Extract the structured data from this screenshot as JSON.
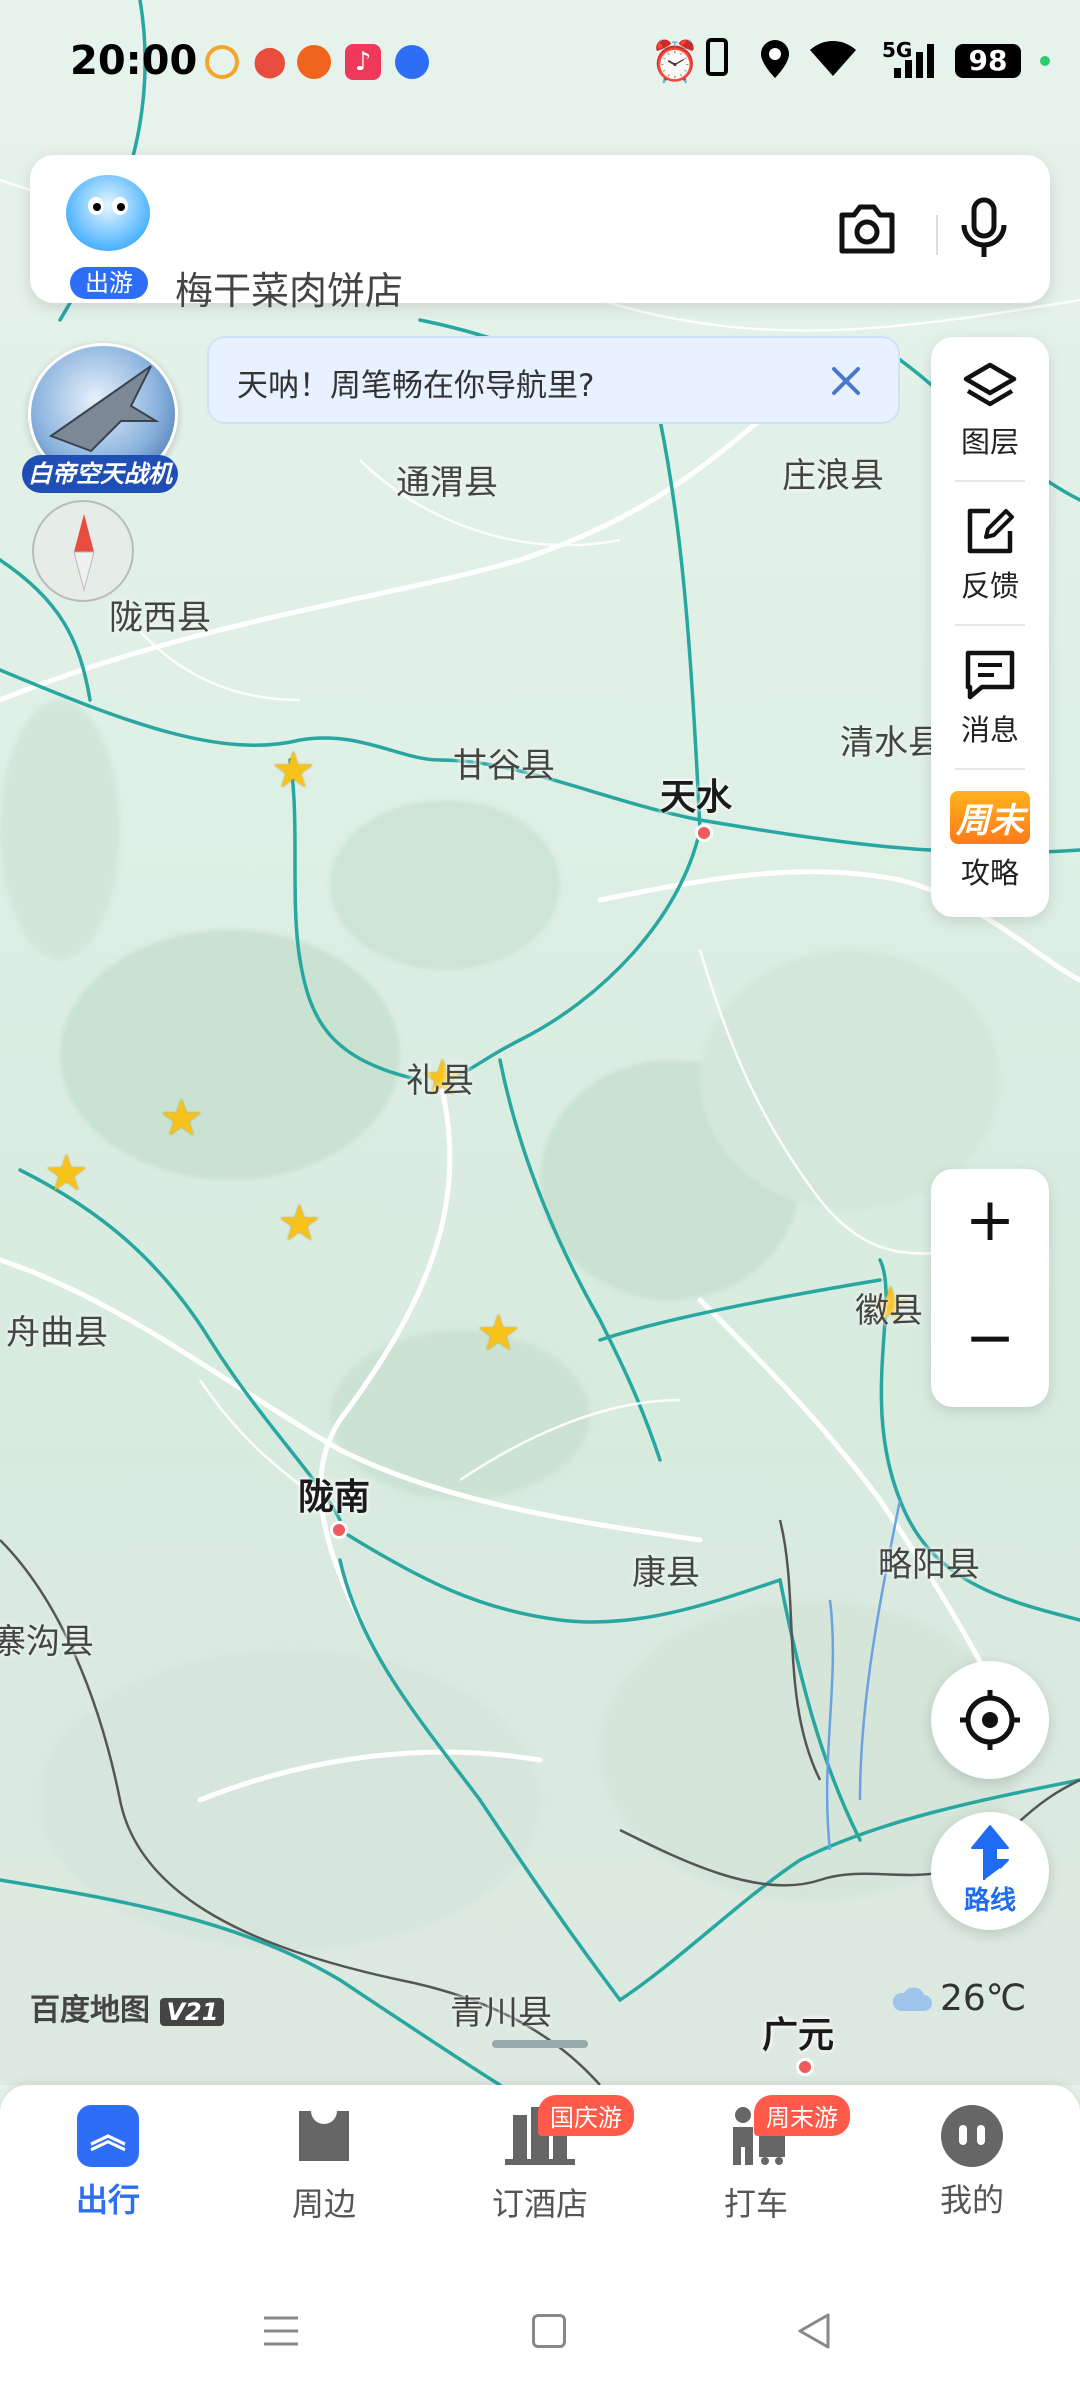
{
  "status_bar": {
    "time": "20:00",
    "network": "5G",
    "battery": "98"
  },
  "search": {
    "avatar_caption": "出游",
    "placeholder_text": "梅干菜肉饼店"
  },
  "promo": {
    "badge_label": "白帝空天战机"
  },
  "notification": {
    "text": "天呐！周笔畅在你导航里?"
  },
  "side_panel": {
    "items": [
      {
        "label": "图层",
        "icon": "layers-icon"
      },
      {
        "label": "反馈",
        "icon": "feedback-icon"
      },
      {
        "label": "消息",
        "icon": "message-icon"
      },
      {
        "label": "攻略",
        "icon": "weekend-guide-icon",
        "icon_text": "周末"
      }
    ]
  },
  "zoom": {
    "plus": "+",
    "minus": "−"
  },
  "route_button": {
    "label": "路线"
  },
  "map": {
    "cities": [
      {
        "name": "天水"
      },
      {
        "name": "陇南"
      },
      {
        "name": "广元"
      }
    ],
    "counties": [
      "通渭县",
      "庄浪县",
      "陇西县",
      "甘谷县",
      "清水县",
      "礼县",
      "徽县",
      "舟曲县",
      "康县",
      "略阳县",
      "寨沟县",
      "青川县"
    ],
    "logo": "百度地图",
    "logo_version": "V21"
  },
  "weather": {
    "temperature": "26℃"
  },
  "bottom_nav": {
    "items": [
      {
        "label": "出行",
        "active": true
      },
      {
        "label": "周边"
      },
      {
        "label": "订酒店",
        "badge": "国庆游"
      },
      {
        "label": "打车",
        "badge": "周末游"
      },
      {
        "label": "我的"
      }
    ]
  },
  "colors": {
    "accent": "#2e6df6",
    "badge": "#ff5a4a",
    "star": "#f7c21b",
    "city_dot": "#f05a5a"
  }
}
